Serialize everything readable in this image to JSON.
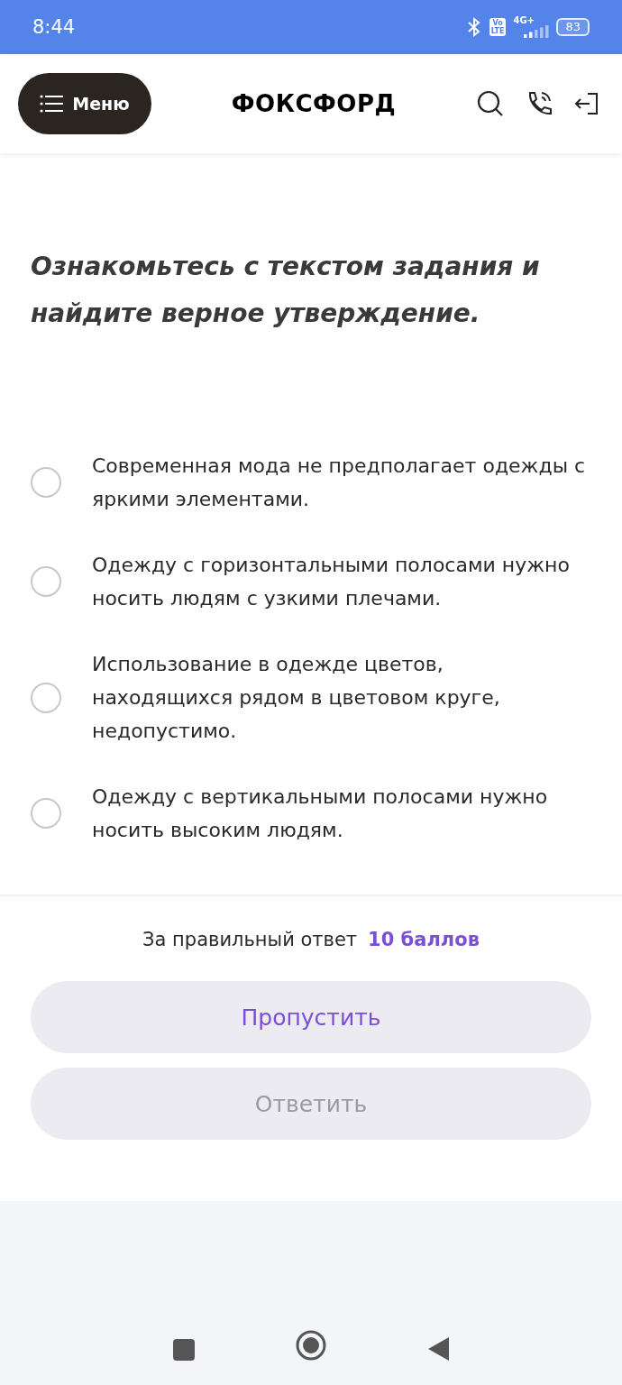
{
  "status_bar": {
    "time": "8:44",
    "volte": [
      "Vo",
      "LTE"
    ],
    "network": "4G+",
    "battery": "83"
  },
  "header": {
    "menu_label": "Меню",
    "logo": "ФОКСФОРД"
  },
  "task": {
    "instruction": "Ознакомьтесь с текстом задания и найдите верное утверждение."
  },
  "options": [
    {
      "text": "Современная мода не предполагает одежды с яркими элементами.",
      "selected": false
    },
    {
      "text": "Одежду с горизонтальными полосами нужно носить людям с узкими плечами.",
      "selected": false
    },
    {
      "text": "Использование в одежде цветов, находящихся рядом в цветовом круге, недопустимо.",
      "selected": false
    },
    {
      "text": "Одежду с вертикальными полосами нужно носить высоким людям.",
      "selected": false
    }
  ],
  "footer": {
    "points_label": "За правильный ответ",
    "points_value": "10 баллов",
    "buttons": [
      {
        "label": "Пропустить",
        "disabled": false
      },
      {
        "label": "Ответить",
        "disabled": true
      }
    ]
  }
}
